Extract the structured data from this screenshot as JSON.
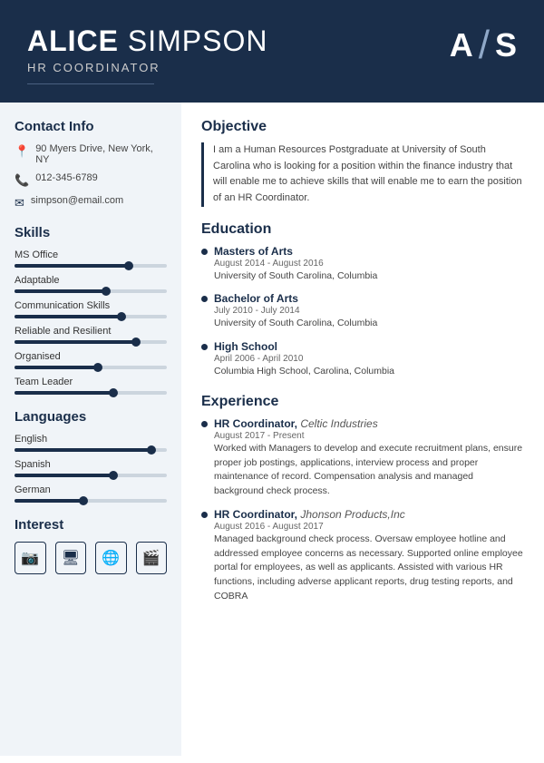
{
  "header": {
    "first_name": "ALICE",
    "last_name": "SIMPSON",
    "title": "HR COORDINATOR",
    "monogram_first": "A",
    "monogram_second": "S"
  },
  "sidebar": {
    "contact": {
      "label": "Contact Info",
      "address": "90 Myers Drive, New York, NY",
      "phone": "012-345-6789",
      "email": "simpson@email.com"
    },
    "skills": {
      "label": "Skills",
      "items": [
        {
          "name": "MS Office",
          "fill": 75,
          "dot": 75
        },
        {
          "name": "Adaptable",
          "fill": 60,
          "dot": 60
        },
        {
          "name": "Communication Skills",
          "fill": 70,
          "dot": 70
        },
        {
          "name": "Reliable and Resilient",
          "fill": 80,
          "dot": 80
        },
        {
          "name": "Organised",
          "fill": 55,
          "dot": 55
        },
        {
          "name": "Team Leader",
          "fill": 65,
          "dot": 65
        }
      ]
    },
    "languages": {
      "label": "Languages",
      "items": [
        {
          "name": "English",
          "fill": 90,
          "dot": 90
        },
        {
          "name": "Spanish",
          "fill": 65,
          "dot": 65
        },
        {
          "name": "German",
          "fill": 45,
          "dot": 45
        }
      ]
    },
    "interest": {
      "label": "Interest",
      "icons": [
        "📷",
        "🖥",
        "🌐",
        "🎬"
      ]
    }
  },
  "content": {
    "objective": {
      "label": "Objective",
      "text": "I am a Human Resources Postgraduate at University of South Carolina who is looking for a position within the finance industry that will enable me to achieve skills that will enable me to earn the position of an HR Coordinator."
    },
    "education": {
      "label": "Education",
      "items": [
        {
          "degree": "Masters of Arts",
          "date": "August 2014 - August 2016",
          "place": "University of South Carolina, Columbia"
        },
        {
          "degree": "Bachelor of Arts",
          "date": "July 2010 - July 2014",
          "place": "University of South Carolina, Columbia"
        },
        {
          "degree": "High School",
          "date": "April 2006 - April 2010",
          "place": "Columbia High School, Carolina, Columbia"
        }
      ]
    },
    "experience": {
      "label": "Experience",
      "items": [
        {
          "title": "HR Coordinator",
          "company": "Celtic Industries",
          "date": "August 2017 - Present",
          "desc": "Worked with Managers to develop and execute recruitment plans, ensure proper job postings, applications, interview process and proper maintenance of record. Compensation analysis and managed background check process."
        },
        {
          "title": "HR Coordinator",
          "company": "Jhonson Products,Inc",
          "date": "August 2016 - August 2017",
          "desc": "Managed background check process. Oversaw employee hotline and addressed employee concerns as necessary. Supported online employee portal for employees, as well as applicants. Assisted with various HR functions, including adverse applicant reports, drug testing reports, and COBRA"
        }
      ]
    }
  }
}
